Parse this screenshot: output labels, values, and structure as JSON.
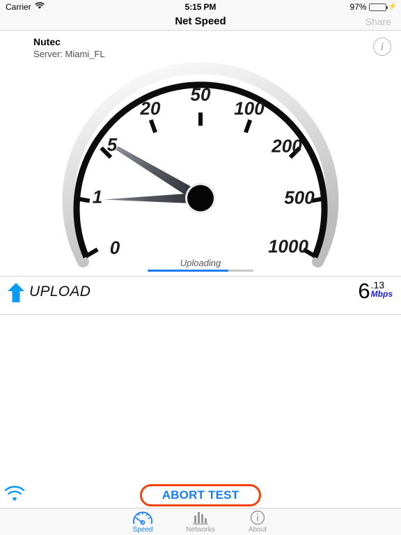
{
  "status_bar": {
    "carrier": "Carrier",
    "wifi_icon": "wifi-icon",
    "time": "5:15 PM",
    "battery_percent": "97%",
    "battery_level": 97,
    "charging_icon": "lightning-bolt-icon"
  },
  "nav_bar": {
    "title": "Net Speed",
    "share_label": "Share",
    "share_enabled": false
  },
  "header": {
    "isp_name": "Nutec",
    "server_line": "Server: Miami_FL",
    "info_icon": "info-circle-icon",
    "info_glyph": "i"
  },
  "gauge": {
    "phase_label": "Uploading",
    "progress_percent": 76,
    "needle_value_label": "5",
    "tick_labels": [
      "0",
      "1",
      "5",
      "20",
      "50",
      "100",
      "200",
      "500",
      "1000"
    ],
    "accent_color": "#1a7cf2"
  },
  "result": {
    "direction_icon": "up-arrow-icon",
    "direction_label": "UPLOAD",
    "value_integer": "6",
    "value_fraction": ".13",
    "unit": "Mbps",
    "unit_color": "#2020e0",
    "arrow_color": "#0a9bf5"
  },
  "bottom": {
    "wifi_icon": "wifi-icon",
    "abort_label": "ABORT TEST",
    "abort_border_color": "#f4420a",
    "abort_text_color": "#1a7cf2"
  },
  "tab_bar": {
    "items": [
      {
        "label": "Speed",
        "icon": "speedometer-icon",
        "active": true
      },
      {
        "label": "Networks",
        "icon": "bar-chart-icon",
        "active": false
      },
      {
        "label": "About",
        "icon": "info-circle-icon",
        "active": false
      }
    ]
  },
  "chart_data": {
    "type": "line",
    "title": "Net Speed gauge",
    "xlabel": "",
    "ylabel": "Mbps",
    "tick_labels": [
      "0",
      "1",
      "5",
      "20",
      "50",
      "100",
      "200",
      "500",
      "1000"
    ],
    "needle_reading": 6.13,
    "needle_unit": "Mbps",
    "progress_percent": 76,
    "phase": "Uploading"
  }
}
